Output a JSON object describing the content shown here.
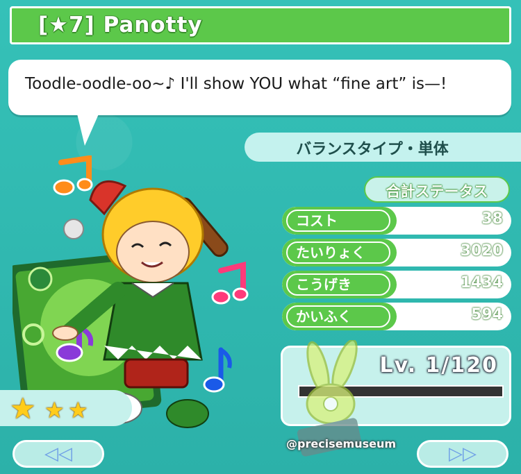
{
  "header": {
    "title": "[★7] Panotty"
  },
  "speech": {
    "text": "Toodle-oodle-oo~♪ I'll show YOU what “fine art” is—!"
  },
  "type_label": "バランスタイプ・単体",
  "total_label": "合計ステータス",
  "stats": [
    {
      "label": "コスト",
      "value": "38"
    },
    {
      "label": "たいりょく",
      "value": "3020"
    },
    {
      "label": "こうげき",
      "value": "1434"
    },
    {
      "label": "かいふく",
      "value": "594"
    }
  ],
  "level": {
    "text": "Lv. 1/120",
    "current": 1,
    "max": 120,
    "exp_fraction": 0.0
  },
  "rarity_stars": 3,
  "watermark": "@precisemuseum",
  "nav": {
    "prev_icon": "double-left-arrow-icon",
    "next_icon": "double-right-arrow-icon",
    "prev": "◁◁",
    "next": "▷▷"
  },
  "colors": {
    "accent_green": "#5cc84a",
    "background": "#2fb8b0",
    "star": "#ffcc1a"
  }
}
